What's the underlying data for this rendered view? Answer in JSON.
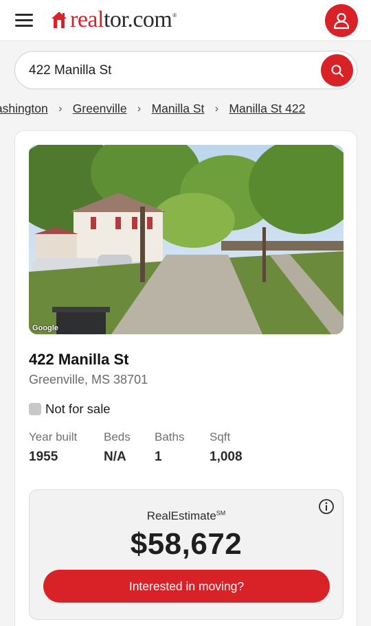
{
  "header": {
    "logo_text_red": "real",
    "logo_text_dark": "tor.com",
    "logo_mark": "®",
    "menu_icon": "hamburger-menu-icon",
    "profile_icon": "user-icon"
  },
  "search": {
    "value": "422 Manilla St",
    "icon": "search-icon"
  },
  "breadcrumbs": [
    "Washington",
    "Greenville",
    "Manilla St",
    "Manilla St 422"
  ],
  "property": {
    "photo_credit": "Google",
    "address": "422 Manilla St",
    "city_state_zip": "Greenville, MS 38701",
    "status": "Not for sale",
    "facts": [
      {
        "label": "Year built",
        "value": "1955"
      },
      {
        "label": "Beds",
        "value": "N/A"
      },
      {
        "label": "Baths",
        "value": "1"
      },
      {
        "label": "Sqft",
        "value": "1,008"
      }
    ]
  },
  "estimate": {
    "title": "RealEstimate",
    "title_mark": "SM",
    "value": "$58,672",
    "button_label": "Interested in moving?",
    "info_icon": "info-icon"
  },
  "colors": {
    "brand_red": "#d92228"
  }
}
